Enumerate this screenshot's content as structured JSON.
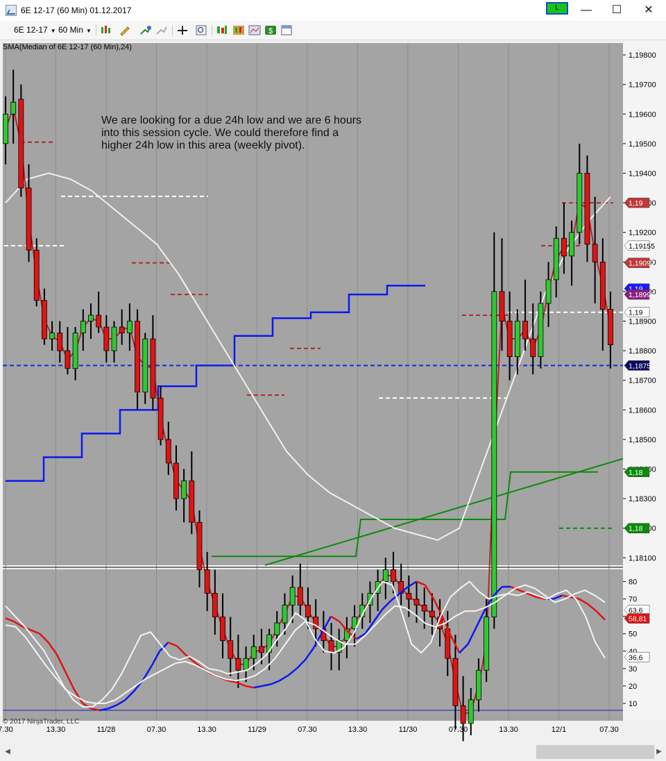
{
  "window": {
    "title": "6E 12-17 (60 Min)  01.12.2017",
    "link_button": "L",
    "minimize": "—",
    "maximize": "☐",
    "close": "✕"
  },
  "toolbar": {
    "instrument": "6E 12-17",
    "interval": "60 Min",
    "icons": [
      "bar-type-icon",
      "drawing-pencil-icon",
      "indicator-add-icon",
      "strategy-icon",
      "crosshair-icon",
      "zoom-icon",
      "data-box-icon",
      "chart-properties-icon",
      "template-icon",
      "dollar-icon",
      "panel-icon"
    ]
  },
  "chart": {
    "indicator_label": "SMA(Median of 6E 12-17 (60 Min),24)",
    "annotation_lines": [
      "We are looking for a due 24h low and we are 6 hours",
      "into this session cycle. We could therefore find a",
      "higher 24h low in this area (weekly pivot)."
    ],
    "copyright": "© 2017 NinjaTrader, LLC",
    "colors": {
      "background": "#a4a4a4",
      "up_candle": "#32c832",
      "down_candle": "#e01414",
      "sma": "#f0f0f0",
      "median_ma": "#b02828",
      "blue_step": "#0b18f0",
      "green_step": "#0b8a0b",
      "pivot_dash_blue": "#1428dc"
    }
  },
  "chart_data": [
    {
      "type": "line",
      "title": "6E 12-17 (60 Min)",
      "yticks": [
        "1,19800",
        "1,19700",
        "1,19600",
        "1,19500",
        "1,19400",
        "1,19300",
        "1,19200",
        "1,19100",
        "1,19000",
        "1,18900",
        "1,18800",
        "1,18700",
        "1,18600",
        "1,18500",
        "1,18400",
        "1,18300",
        "1,18200",
        "1,18100"
      ],
      "ylim": [
        1.18075,
        1.1984
      ],
      "xticks": [
        "7.30",
        "13.30",
        "11/28",
        "07.30",
        "13.30",
        "11/29",
        "07.30",
        "13.30",
        "11/30",
        "07.30",
        "13.30",
        "12/1",
        "07.30"
      ],
      "price_markers": [
        {
          "label": "1,19",
          "value": 1.193,
          "color": "#c03838"
        },
        {
          "label": "1,19155",
          "value": 1.19155,
          "color": "#ffffff"
        },
        {
          "label": "1,19097",
          "value": 1.19097,
          "color": "#c03838"
        },
        {
          "label": "1,19",
          "value": 1.1901,
          "color": "#1a1aff"
        },
        {
          "label": "1,18990",
          "value": 1.1899,
          "color": "#8a2080"
        },
        {
          "label": "1,19",
          "value": 1.1893,
          "color": "#ffffff"
        },
        {
          "label": "1,18750",
          "value": 1.1875,
          "color": "#0a0a60"
        },
        {
          "label": "1,18",
          "value": 1.1839,
          "color": "#0b8a0b"
        },
        {
          "label": "1,18",
          "value": 1.182,
          "color": "#0b8a0b"
        }
      ],
      "candles": [
        [
          1.195,
          1.1966,
          1.1943,
          1.196
        ],
        [
          1.196,
          1.1975,
          1.195,
          1.1964
        ],
        [
          1.1965,
          1.197,
          1.1932,
          1.1935
        ],
        [
          1.1935,
          1.1943,
          1.191,
          1.1914
        ],
        [
          1.1914,
          1.1918,
          1.1895,
          1.1897
        ],
        [
          1.1897,
          1.1901,
          1.1882,
          1.1884
        ],
        [
          1.1884,
          1.189,
          1.188,
          1.1886
        ],
        [
          1.1886,
          1.189,
          1.1876,
          1.188
        ],
        [
          1.188,
          1.1888,
          1.1872,
          1.1874
        ],
        [
          1.1874,
          1.1888,
          1.187,
          1.1886
        ],
        [
          1.1886,
          1.1894,
          1.188,
          1.189
        ],
        [
          1.189,
          1.1896,
          1.1884,
          1.1892
        ],
        [
          1.1892,
          1.19,
          1.1886,
          1.1888
        ],
        [
          1.1888,
          1.1892,
          1.1876,
          1.188
        ],
        [
          1.188,
          1.189,
          1.1876,
          1.1888
        ],
        [
          1.1888,
          1.1894,
          1.1882,
          1.1886
        ],
        [
          1.1886,
          1.1896,
          1.188,
          1.189
        ],
        [
          1.189,
          1.1894,
          1.186,
          1.1866
        ],
        [
          1.1866,
          1.1886,
          1.1862,
          1.1884
        ],
        [
          1.1884,
          1.1892,
          1.186,
          1.1864
        ],
        [
          1.1864,
          1.1868,
          1.1848,
          1.185
        ],
        [
          1.185,
          1.1856,
          1.1838,
          1.1842
        ],
        [
          1.1842,
          1.1848,
          1.1826,
          1.183
        ],
        [
          1.183,
          1.184,
          1.1822,
          1.1836
        ],
        [
          1.1836,
          1.1846,
          1.1818,
          1.1822
        ],
        [
          1.1822,
          1.1826,
          1.18,
          1.1806
        ],
        [
          1.1806,
          1.1812,
          1.1792,
          1.1798
        ],
        [
          1.1798,
          1.1806,
          1.1784,
          1.179
        ],
        [
          1.179,
          1.1798,
          1.1776,
          1.1782
        ],
        [
          1.1782,
          1.179,
          1.177,
          1.1776
        ],
        [
          1.1776,
          1.1784,
          1.1766,
          1.1772
        ],
        [
          1.1772,
          1.178,
          1.1768,
          1.1776
        ],
        [
          1.1776,
          1.1784,
          1.1772,
          1.178
        ],
        [
          1.178,
          1.1786,
          1.1774,
          1.1778
        ],
        [
          1.1778,
          1.1786,
          1.1772,
          1.1784
        ],
        [
          1.1784,
          1.1792,
          1.178,
          1.1788
        ],
        [
          1.1788,
          1.1798,
          1.1784,
          1.1794
        ],
        [
          1.1794,
          1.1804,
          1.1788,
          1.18
        ],
        [
          1.18,
          1.1808,
          1.179,
          1.1794
        ],
        [
          1.1794,
          1.18,
          1.1786,
          1.179
        ],
        [
          1.179,
          1.1796,
          1.178,
          1.1786
        ],
        [
          1.1786,
          1.1792,
          1.1778,
          1.1782
        ],
        [
          1.1782,
          1.1788,
          1.1772,
          1.1778
        ],
        [
          1.1778,
          1.1786,
          1.1772,
          1.1782
        ],
        [
          1.1782,
          1.179,
          1.1776,
          1.1786
        ],
        [
          1.1786,
          1.1794,
          1.178,
          1.179
        ],
        [
          1.179,
          1.1798,
          1.1786,
          1.1794
        ],
        [
          1.1794,
          1.1802,
          1.1788,
          1.1798
        ],
        [
          1.1798,
          1.1806,
          1.1792,
          1.1802
        ],
        [
          1.1802,
          1.181,
          1.1796,
          1.1806
        ],
        [
          1.1806,
          1.1812,
          1.1798,
          1.1802
        ],
        [
          1.1802,
          1.1808,
          1.1794,
          1.1798
        ],
        [
          1.1798,
          1.1804,
          1.179,
          1.1796
        ],
        [
          1.1796,
          1.1802,
          1.1788,
          1.1794
        ],
        [
          1.1794,
          1.18,
          1.1786,
          1.1792
        ],
        [
          1.1792,
          1.1798,
          1.1784,
          1.179
        ],
        [
          1.179,
          1.1796,
          1.178,
          1.1786
        ],
        [
          1.1786,
          1.1792,
          1.177,
          1.1776
        ],
        [
          1.1776,
          1.1784,
          1.1752,
          1.176
        ],
        [
          1.176,
          1.177,
          1.1748,
          1.1754
        ],
        [
          1.1754,
          1.1766,
          1.175,
          1.1762
        ],
        [
          1.1762,
          1.1776,
          1.1758,
          1.1772
        ],
        [
          1.1772,
          1.1796,
          1.1768,
          1.179
        ],
        [
          1.179,
          1.192,
          1.1786,
          1.19
        ],
        [
          1.19,
          1.1918,
          1.188,
          1.189
        ],
        [
          1.189,
          1.19,
          1.187,
          1.1878
        ],
        [
          1.1878,
          1.1894,
          1.1872,
          1.189
        ],
        [
          1.189,
          1.1904,
          1.188,
          1.1884
        ],
        [
          1.1884,
          1.1896,
          1.1872,
          1.1878
        ],
        [
          1.1878,
          1.19,
          1.1874,
          1.1896
        ],
        [
          1.1896,
          1.191,
          1.1888,
          1.1904
        ],
        [
          1.1904,
          1.1922,
          1.1898,
          1.1918
        ],
        [
          1.1918,
          1.193,
          1.1906,
          1.1912
        ],
        [
          1.1912,
          1.1924,
          1.1902,
          1.192
        ],
        [
          1.192,
          1.195,
          1.1916,
          1.194
        ],
        [
          1.194,
          1.1946,
          1.191,
          1.1916
        ],
        [
          1.1916,
          1.1932,
          1.1896,
          1.191
        ],
        [
          1.191,
          1.1918,
          1.188,
          1.1894
        ],
        [
          1.1894,
          1.19,
          1.1874,
          1.1882
        ]
      ],
      "series": [
        {
          "name": "SMA(Median of 6E 12-17 (60 Min),24)",
          "values": [
            1.193,
            1.1938,
            1.194,
            1.1938,
            1.1934,
            1.1928,
            1.1922,
            1.1916,
            1.1906,
            1.1894,
            1.1882,
            1.187,
            1.1858,
            1.1846,
            1.1838,
            1.1832,
            1.1828,
            1.1824,
            1.182,
            1.1818,
            1.1816,
            1.182,
            1.184,
            1.186,
            1.188,
            1.19,
            1.1914,
            1.1924,
            1.1932
          ]
        }
      ]
    },
    {
      "type": "line",
      "title": "",
      "yticks": [
        "80",
        "70",
        "60",
        "50",
        "40",
        "30",
        "20",
        "10"
      ],
      "ylim": [
        0,
        87
      ],
      "price_markers": [
        {
          "label": "63,6",
          "value": 63.6,
          "color": "#ffffff"
        },
        {
          "label": "58,81",
          "value": 58.81,
          "color": "#e01414"
        },
        {
          "label": "36,6",
          "value": 36.6,
          "color": "#ffffff"
        }
      ],
      "series": [
        {
          "name": "",
          "values": [
            59,
            57,
            54,
            52,
            50,
            45,
            38,
            28,
            18,
            10,
            7,
            6,
            7,
            9,
            12,
            17,
            23,
            31,
            40,
            45,
            43,
            38,
            34,
            30,
            27,
            25,
            23,
            22,
            20,
            19,
            20,
            21,
            23,
            26,
            30,
            35,
            42,
            51,
            60,
            57,
            51,
            47,
            50,
            57,
            64,
            69,
            73,
            77,
            80,
            78,
            70,
            60,
            49,
            39,
            44,
            54,
            64,
            72,
            77,
            77,
            75,
            73,
            71,
            70,
            70,
            72,
            71,
            70,
            67,
            63,
            58
          ]
        },
        {
          "name": "",
          "values": [
            66,
            60,
            54,
            47,
            40,
            30,
            20,
            12,
            8,
            8,
            12,
            18,
            27,
            38,
            49,
            51,
            44,
            37,
            35,
            37,
            34,
            30,
            29,
            27,
            28,
            29,
            33,
            38,
            46,
            53,
            62,
            58,
            47,
            40,
            39,
            42,
            50,
            62,
            72,
            80,
            78,
            62,
            44,
            39,
            45,
            60,
            71,
            76,
            80,
            74,
            70,
            72,
            73,
            72,
            74,
            72,
            70,
            73,
            75,
            70,
            60,
            45,
            36
          ]
        },
        {
          "name": "",
          "values": [
            55,
            54,
            48,
            40,
            32,
            25,
            18,
            14,
            11,
            10,
            10,
            12,
            16,
            20,
            24,
            27,
            30,
            33,
            34,
            32,
            29,
            26,
            24,
            23,
            24,
            26,
            30,
            36,
            44,
            52,
            57,
            55,
            51,
            47,
            44,
            44,
            49,
            55,
            61,
            66,
            65,
            61,
            56,
            54,
            56,
            60,
            63,
            63,
            65,
            68,
            72,
            76,
            78,
            76,
            72,
            68,
            70,
            73,
            75,
            72,
            68
          ]
        }
      ]
    }
  ]
}
